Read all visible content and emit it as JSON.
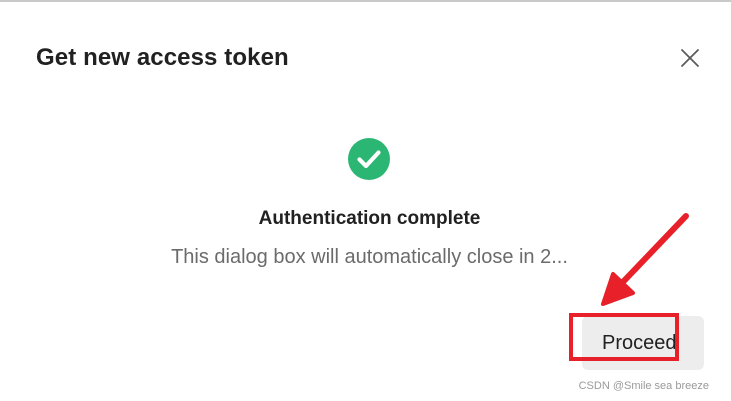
{
  "dialog": {
    "title": "Get new access token",
    "close_icon": "close-icon",
    "status_icon": "check-circle-icon",
    "status_color": "#2bb673",
    "status_title": "Authentication complete",
    "status_message": "This dialog box will automatically close in 2...",
    "proceed_label": "Proceed"
  },
  "annotation": {
    "color": "#e8202a",
    "arrow_icon": "red-arrow-icon"
  },
  "watermark": {
    "text": "CSDN @Smile sea breeze"
  }
}
